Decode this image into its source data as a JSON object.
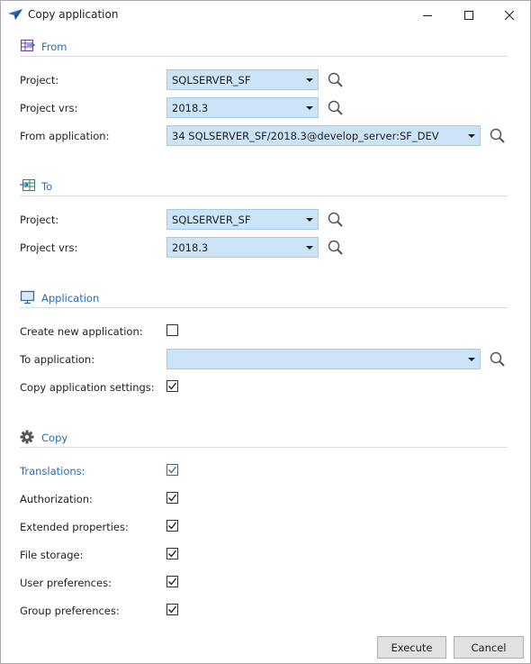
{
  "window": {
    "title": "Copy application"
  },
  "sections": {
    "from": {
      "title": "From"
    },
    "to": {
      "title": "To"
    },
    "application": {
      "title": "Application"
    },
    "copy": {
      "title": "Copy"
    }
  },
  "from": {
    "project_label": "Project:",
    "project_value": "SQLSERVER_SF",
    "project_vrs_label": "Project vrs:",
    "project_vrs_value": "2018.3",
    "from_application_label": "From application:",
    "from_application_value": "34 SQLSERVER_SF/2018.3@develop_server:SF_DEV"
  },
  "to": {
    "project_label": "Project:",
    "project_value": "SQLSERVER_SF",
    "project_vrs_label": "Project vrs:",
    "project_vrs_value": "2018.3"
  },
  "application": {
    "create_new_label": "Create new application:",
    "create_new_checked": false,
    "to_application_label": "To application:",
    "to_application_value": "",
    "copy_settings_label": "Copy application settings:",
    "copy_settings_checked": true
  },
  "copy": {
    "items": [
      {
        "label": "Translations:",
        "checked": true
      },
      {
        "label": "Authorization:",
        "checked": true
      },
      {
        "label": "Extended properties:",
        "checked": true
      },
      {
        "label": "File storage:",
        "checked": true
      },
      {
        "label": "User preferences:",
        "checked": true
      },
      {
        "label": "Group preferences:",
        "checked": true
      }
    ]
  },
  "buttons": {
    "execute": "Execute",
    "cancel": "Cancel"
  },
  "colors": {
    "accent": "#2a6bb5",
    "combo_bg": "#cce4f7",
    "button_bg": "#e1e1e1"
  }
}
